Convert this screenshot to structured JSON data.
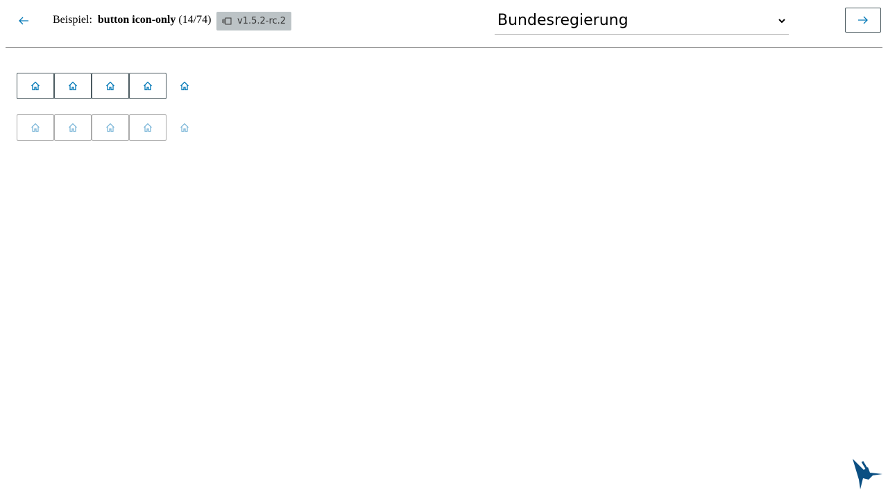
{
  "header": {
    "prefix": "Beispiel:",
    "component": "button icon-only",
    "counter": "(14/74)",
    "version": "v1.5.2-rc.2",
    "theme_select": "Bundesregierung"
  },
  "colors": {
    "accent": "#0077b6",
    "border": "#4b5a60",
    "disabled_icon": "#7fb8d9"
  },
  "rows": [
    {
      "state": "enabled",
      "icons": [
        "home-icon",
        "home-icon",
        "home-icon",
        "home-icon",
        "home-icon"
      ]
    },
    {
      "state": "disabled",
      "icons": [
        "home-icon",
        "home-icon",
        "home-icon",
        "home-icon",
        "home-icon"
      ]
    }
  ]
}
